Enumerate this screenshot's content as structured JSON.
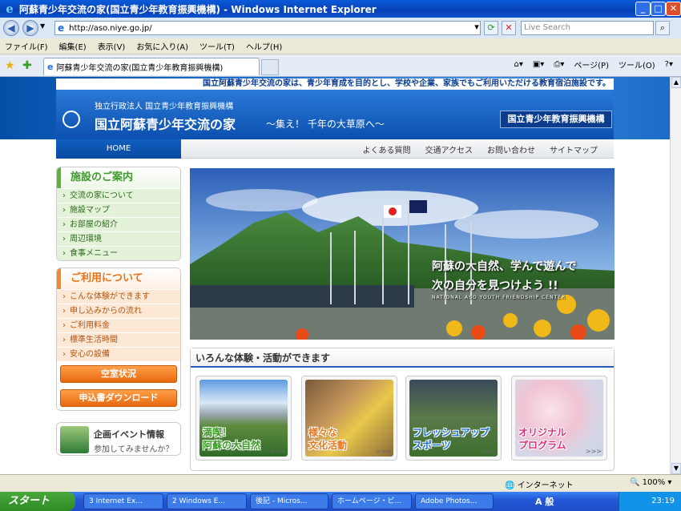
{
  "window": {
    "title": "阿蘇青少年交流の家(国立青少年教育振興機構) - Windows Internet Explorer"
  },
  "address": {
    "url": "http://aso.niye.go.jp/",
    "search_placeholder": "Live Search"
  },
  "menu": [
    "ファイル(F)",
    "編集(E)",
    "表示(V)",
    "お気に入り(A)",
    "ツール(T)",
    "ヘルプ(H)"
  ],
  "tab": {
    "label": "阿蘇青少年交流の家(国立青少年教育振興機構)"
  },
  "toolbar": {
    "page": "ページ(P)",
    "tools": "ツール(O)"
  },
  "header": {
    "tagline": "国立阿蘇青少年交流の家は、青少年育成を目的とし、学校や企業、家族でもご利用いただける教育宿泊施設です。",
    "org": "独立行政法人 国立青少年教育振興機構",
    "site_name": "国立阿蘇青少年交流の家",
    "catch": "～集え！ 千年の大草原へ～",
    "org_button": "国立青少年教育振興機構"
  },
  "nav": {
    "home": "HOME",
    "links": [
      "よくある質問",
      "交通アクセス",
      "お問い合わせ",
      "サイトマップ"
    ]
  },
  "sidebar": {
    "facility": {
      "title": "施設のご案内",
      "items": [
        "交流の家について",
        "施設マップ",
        "お部屋の紹介",
        "周辺環境",
        "食事メニュー"
      ]
    },
    "usage": {
      "title": "ご利用について",
      "items": [
        "こんな体験ができます",
        "申し込みからの流れ",
        "ご利用料金",
        "標準生活時間",
        "安心の設備"
      ]
    },
    "buttons": [
      "空室状況",
      "申込書ダウンロード"
    ],
    "event": {
      "title": "企画イベント情報",
      "sub": "参加してみませんか？"
    }
  },
  "hero": {
    "line1": "阿蘇の大自然、学んで遊んで",
    "line2": "次の自分を見つけよう !!",
    "sub": "NATIONAL ASO YOUTH FRIENDSHIP CENTER"
  },
  "activities": {
    "title": "いろんな体験・活動ができます",
    "cards": [
      {
        "l1": "満喫！",
        "l2": "阿蘇の大自然",
        "color": "#3a9a24"
      },
      {
        "l1": "様々な",
        "l2": "文化活動",
        "color": "#e8771c"
      },
      {
        "l1": "フレッシュアップ",
        "l2": "スポーツ",
        "color": "#1e6fd0"
      },
      {
        "l1": "オリジナル",
        "l2": "プログラム",
        "color": "#d8327a"
      }
    ],
    "arrow": ">>>"
  },
  "status": {
    "zone": "インターネット",
    "zoom": "100%"
  },
  "taskbar": {
    "start": "スタート",
    "items": [
      "3 Internet Ex...",
      "2 Windows E...",
      "後記 - Micros...",
      "ホームページ・ビ...",
      "Adobe Photos..."
    ],
    "tray_text": "A 般",
    "clock": "23:19"
  },
  "colors": {
    "brand_blue": "#0a4aa0",
    "green": "#5bb33a",
    "orange": "#f08a2e"
  }
}
